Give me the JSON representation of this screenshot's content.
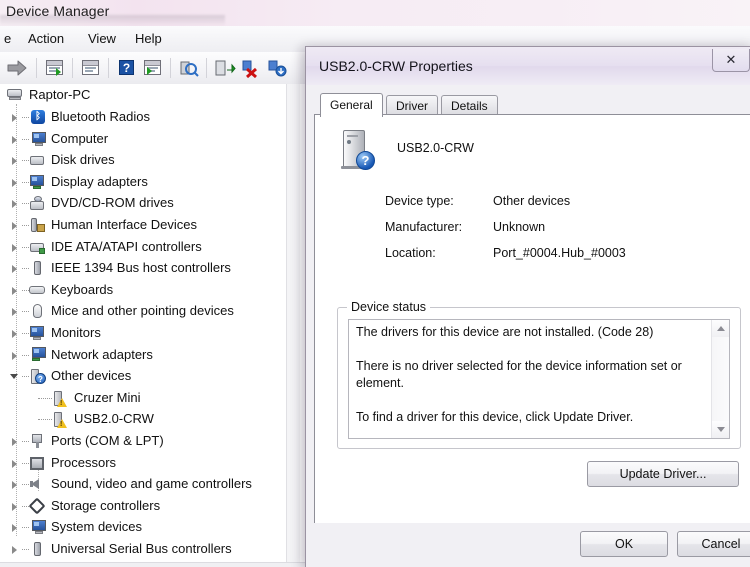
{
  "main_window": {
    "title": "Device Manager",
    "menu": [
      {
        "label": "e",
        "name": "menu-file"
      },
      {
        "label": "Action",
        "name": "menu-action"
      },
      {
        "label": "View",
        "name": "menu-view"
      },
      {
        "label": "Help",
        "name": "menu-help"
      }
    ],
    "toolbar": [
      {
        "icon": "forward-arrow-icon",
        "label": ""
      },
      {
        "icon": "properties-window-icon",
        "label": ""
      },
      {
        "icon": "show-hidden-window-icon",
        "label": ""
      },
      {
        "icon": "help-icon",
        "label": "?"
      },
      {
        "icon": "console-window-icon",
        "label": ""
      },
      {
        "icon": "update-driver-icon",
        "label": ""
      },
      {
        "icon": "scan-hardware-changes-icon",
        "label": ""
      },
      {
        "icon": "uninstall-device-icon",
        "label": ""
      },
      {
        "icon": "enable-device-icon",
        "label": ""
      }
    ],
    "tree": {
      "root": {
        "label": "Raptor-PC",
        "icon": "computer-icon"
      },
      "items": [
        {
          "label": "Bluetooth Radios",
          "icon": "bluetooth-icon",
          "state": "collapsed",
          "depth": 1
        },
        {
          "label": "Computer",
          "icon": "computer-icon",
          "state": "collapsed",
          "depth": 1
        },
        {
          "label": "Disk drives",
          "icon": "disk-drive-icon",
          "state": "collapsed",
          "depth": 1
        },
        {
          "label": "Display adapters",
          "icon": "display-adapter-icon",
          "state": "collapsed",
          "depth": 1
        },
        {
          "label": "DVD/CD-ROM drives",
          "icon": "dvd-drive-icon",
          "state": "collapsed",
          "depth": 1
        },
        {
          "label": "Human Interface Devices",
          "icon": "hid-icon",
          "state": "collapsed",
          "depth": 1
        },
        {
          "label": "IDE ATA/ATAPI controllers",
          "icon": "ide-controller-icon",
          "state": "collapsed",
          "depth": 1
        },
        {
          "label": "IEEE 1394 Bus host controllers",
          "icon": "firewire-icon",
          "state": "collapsed",
          "depth": 1
        },
        {
          "label": "Keyboards",
          "icon": "keyboard-icon",
          "state": "collapsed",
          "depth": 1
        },
        {
          "label": "Mice and other pointing devices",
          "icon": "mouse-icon",
          "state": "collapsed",
          "depth": 1
        },
        {
          "label": "Monitors",
          "icon": "monitor-icon",
          "state": "collapsed",
          "depth": 1
        },
        {
          "label": "Network adapters",
          "icon": "network-adapter-icon",
          "state": "collapsed",
          "depth": 1
        },
        {
          "label": "Other devices",
          "icon": "unknown-device-icon",
          "state": "expanded",
          "depth": 1
        },
        {
          "label": "Cruzer Mini",
          "icon": "warning-device-icon",
          "state": "leaf",
          "depth": 2
        },
        {
          "label": "USB2.0-CRW",
          "icon": "warning-device-icon",
          "state": "leaf",
          "depth": 2
        },
        {
          "label": "Ports (COM & LPT)",
          "icon": "port-icon",
          "state": "collapsed",
          "depth": 1
        },
        {
          "label": "Processors",
          "icon": "processor-icon",
          "state": "collapsed",
          "depth": 1
        },
        {
          "label": "Sound, video and game controllers",
          "icon": "sound-icon",
          "state": "collapsed",
          "depth": 1
        },
        {
          "label": "Storage controllers",
          "icon": "storage-controller-icon",
          "state": "collapsed",
          "depth": 1
        },
        {
          "label": "System devices",
          "icon": "system-device-icon",
          "state": "collapsed",
          "depth": 1
        },
        {
          "label": "Universal Serial Bus controllers",
          "icon": "usb-controller-icon",
          "state": "collapsed",
          "depth": 1
        }
      ]
    }
  },
  "dialog": {
    "title": "USB2.0-CRW Properties",
    "close_glyph": "✕",
    "tabs": [
      {
        "label": "General",
        "active": true
      },
      {
        "label": "Driver",
        "active": false
      },
      {
        "label": "Details",
        "active": false
      }
    ],
    "device_name": "USB2.0-CRW",
    "device_icon": "unknown-device-icon",
    "info": [
      {
        "label": "Device type:",
        "value": "Other devices"
      },
      {
        "label": "Manufacturer:",
        "value": "Unknown"
      },
      {
        "label": "Location:",
        "value": "Port_#0004.Hub_#0003"
      }
    ],
    "status_group_label": "Device status",
    "status_lines": [
      "The drivers for this device are not installed. (Code 28)",
      "There is no driver selected for the device information set or element.",
      "",
      "To find a driver for this device, click Update Driver."
    ],
    "update_button": "Update Driver...",
    "ok_button": "OK",
    "cancel_button": "Cancel"
  },
  "colors": {
    "title_accent": "#f3e3ef",
    "dialog_title": "#e6dff0",
    "warning": "#f0c020",
    "help_blue": "#1b52a4"
  }
}
